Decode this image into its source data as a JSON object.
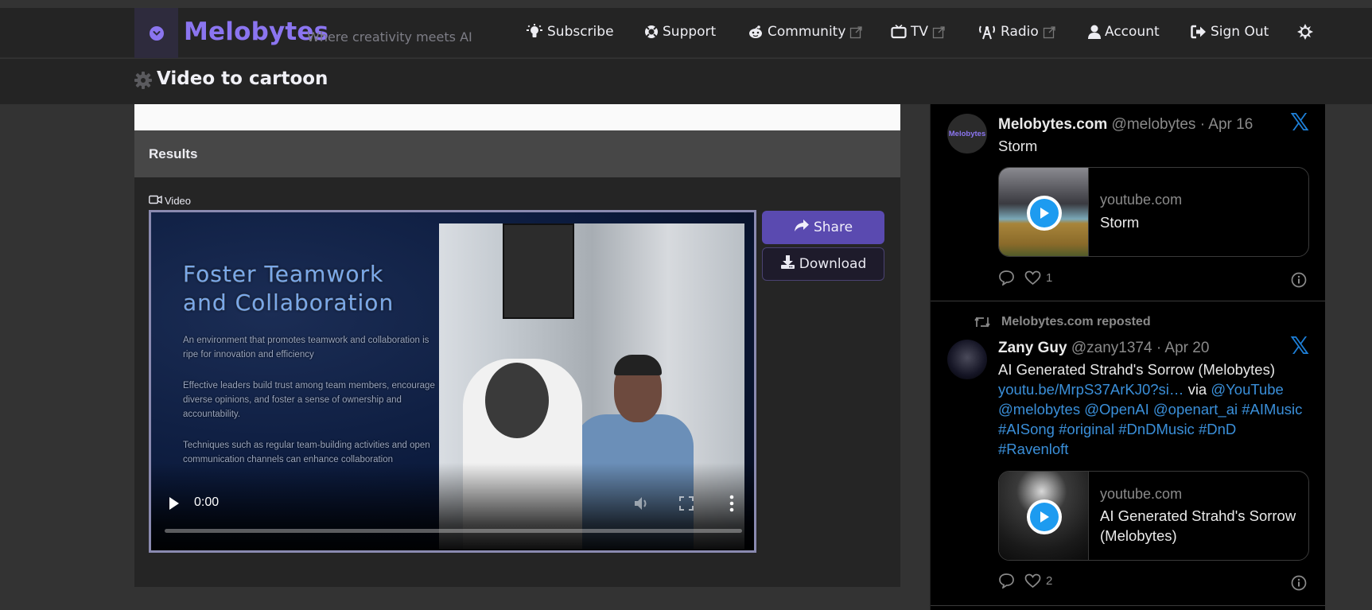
{
  "header": {
    "brand": "Melobytes",
    "tagline": "Where creativity meets AI",
    "nav": [
      {
        "label": "Subscribe",
        "icon": "lightbulb-icon",
        "external": false
      },
      {
        "label": "Support",
        "icon": "lifebuoy-icon",
        "external": false
      },
      {
        "label": "Community",
        "icon": "reddit-icon",
        "external": true
      },
      {
        "label": "TV",
        "icon": "tv-icon",
        "external": true
      },
      {
        "label": "Radio",
        "icon": "radio-tower-icon",
        "external": true
      },
      {
        "label": "Account",
        "icon": "user-icon",
        "external": false
      },
      {
        "label": "Sign Out",
        "icon": "sign-out-icon",
        "external": false
      }
    ],
    "theme_toggle_icon": "sun-icon"
  },
  "page": {
    "title": "Video to cartoon",
    "title_icon": "gear-icon"
  },
  "results": {
    "heading": "Results",
    "video_label": "Video",
    "video": {
      "slide_title_line1": "Foster Teamwork",
      "slide_title_line2": "and Collaboration",
      "slide_paragraphs": [
        "An environment that promotes teamwork and collaboration is ripe for innovation and efficiency",
        "Effective leaders build trust among team members, encourage diverse opinions, and foster a sense of ownership and accountability.",
        "Techniques such as regular team-building activities and open communication channels can enhance collaboration"
      ],
      "current_time": "0:00",
      "progress": 0
    },
    "share_label": "Share",
    "download_label": "Download"
  },
  "feed": {
    "tweets": [
      {
        "name": "Melobytes.com",
        "handle": "@melobytes",
        "date": "Apr 16",
        "avatar_text": "Melobytes",
        "text": "Storm",
        "card": {
          "domain": "youtube.com",
          "title": "Storm"
        },
        "likes": "1"
      },
      {
        "repost_by": "Melobytes.com reposted",
        "name": "Zany Guy",
        "handle": "@zany1374",
        "date": "Apr 20",
        "text": "AI Generated Strahd's Sorrow (Melobytes)",
        "link": "youtu.be/MrpS37ArKJ0?si…",
        "via": "via",
        "mentions": [
          "@YouTube",
          "@melobytes",
          "@OpenAI",
          "@openart_ai",
          "#AIMusic",
          "#AISong",
          "#original",
          "#DnDMusic",
          "#DnD",
          "#Ravenloft"
        ],
        "card": {
          "domain": "youtube.com",
          "title": "AI Generated Strahd's Sorrow (Melobytes)"
        },
        "likes": "2"
      }
    ],
    "separator": "·"
  }
}
